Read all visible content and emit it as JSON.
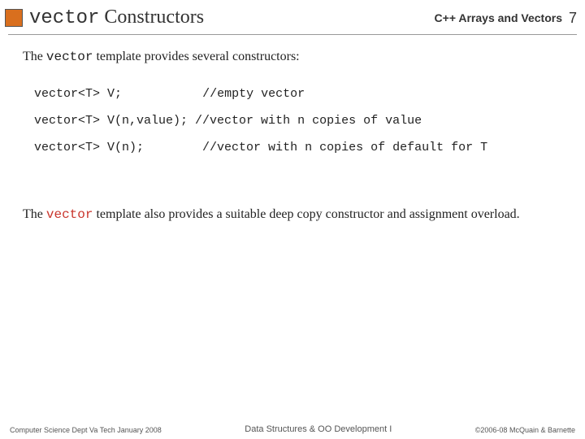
{
  "header": {
    "title_code": "vector",
    "title_rest": " Constructors",
    "subtitle": "C++ Arrays and Vectors",
    "page_number": "7"
  },
  "intro": {
    "prefix": "The ",
    "code": "vector",
    "suffix": " template provides several constructors:"
  },
  "code": {
    "l1a": "vector<T> V;",
    "l1b": "//empty vector",
    "l2a": "vector<T> V(n,value);",
    "l2b": "//vector with n copies of value",
    "l3a": "vector<T> V(n);",
    "l3b": "//vector with n copies of default for T"
  },
  "para2": {
    "prefix": "The ",
    "code": "vector",
    "suffix": " template also provides a suitable deep copy constructor and assignment overload."
  },
  "footer": {
    "left": "Computer Science Dept Va Tech January 2008",
    "center": "Data Structures & OO Development I",
    "right": "©2006-08 McQuain & Barnette"
  }
}
